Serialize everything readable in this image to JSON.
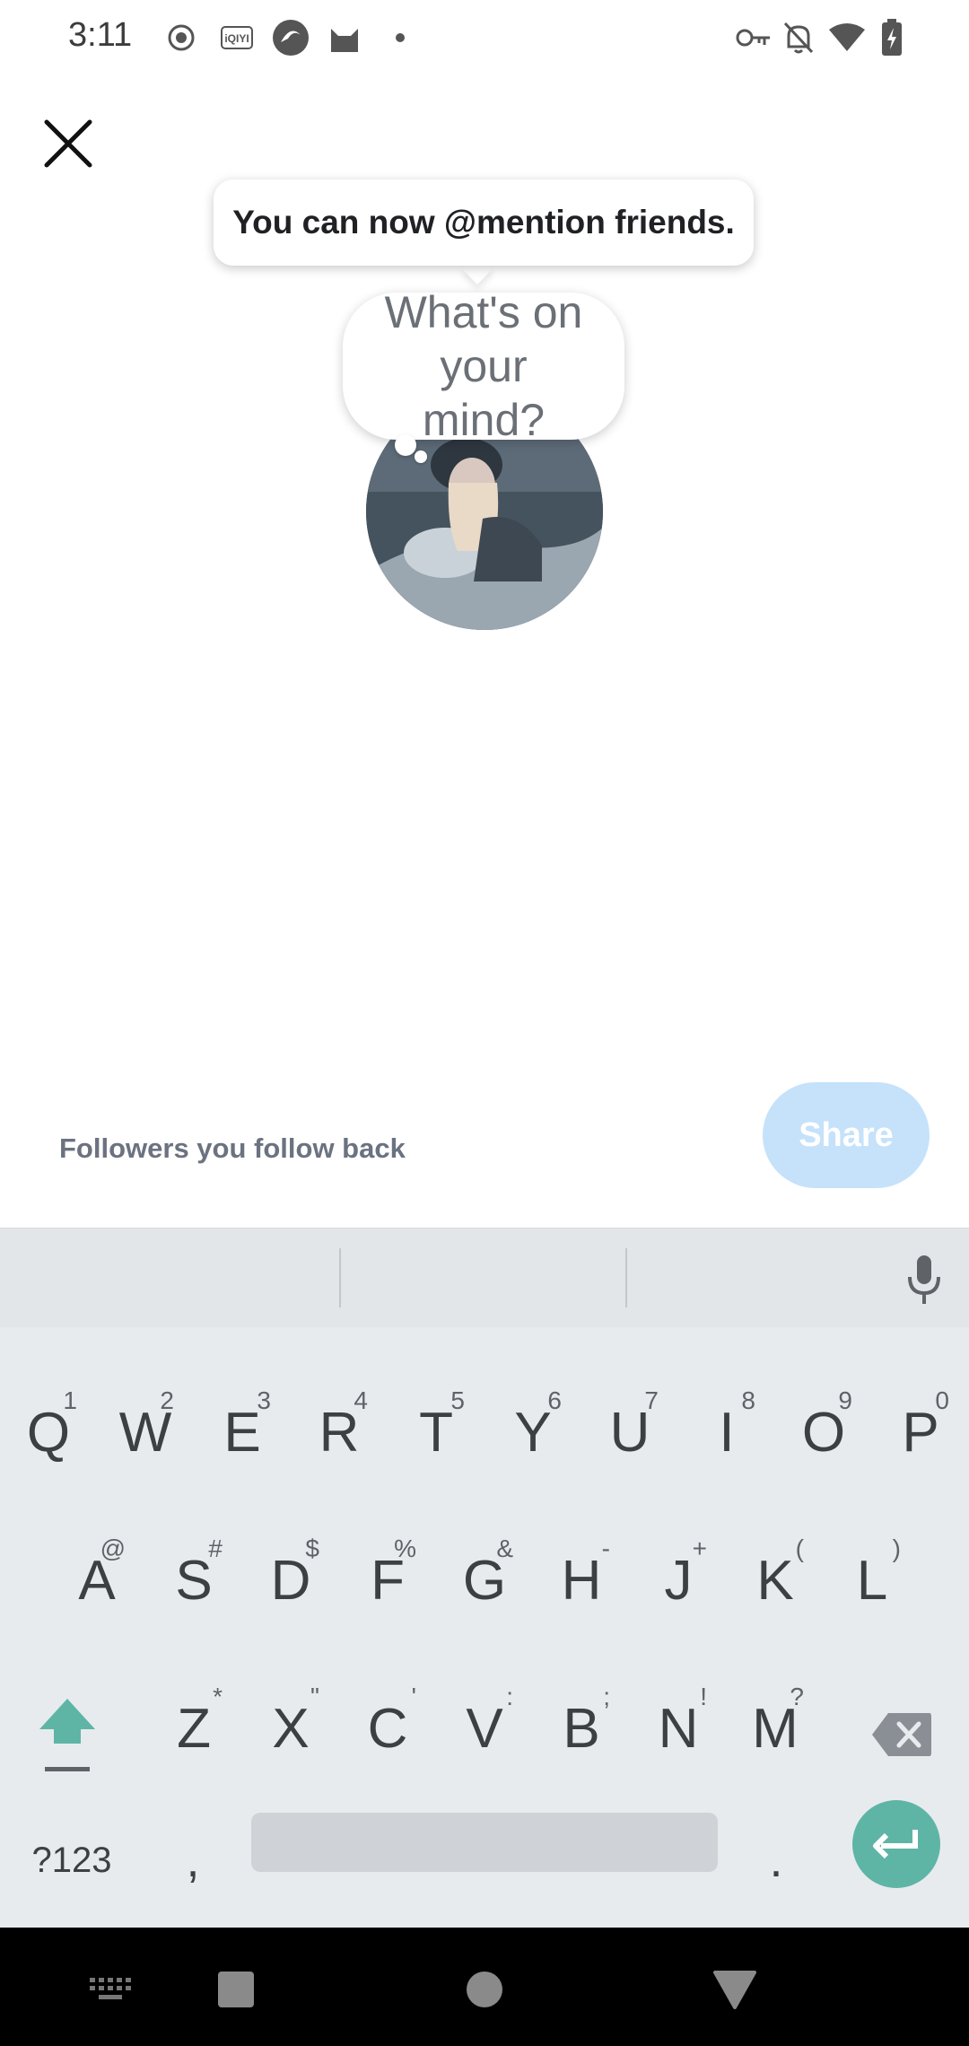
{
  "status_bar": {
    "time": "3:11",
    "left_icons": [
      "record-icon",
      "iqiyi-icon",
      "browser-icon",
      "cat-icon",
      "dot-icon"
    ],
    "right_icons": [
      "vpn-key-icon",
      "mute-bell-icon",
      "wifi-icon",
      "battery-charging-icon"
    ]
  },
  "composer": {
    "tooltip": "You can now @mention friends.",
    "placeholder": "What's on your mind?",
    "audience_label": "Followers you follow back",
    "share_label": "Share",
    "share_color": "#c5e2fa"
  },
  "keyboard": {
    "row1": [
      {
        "k": "Q",
        "h": "1"
      },
      {
        "k": "W",
        "h": "2"
      },
      {
        "k": "E",
        "h": "3"
      },
      {
        "k": "R",
        "h": "4"
      },
      {
        "k": "T",
        "h": "5"
      },
      {
        "k": "Y",
        "h": "6"
      },
      {
        "k": "U",
        "h": "7"
      },
      {
        "k": "I",
        "h": "8"
      },
      {
        "k": "O",
        "h": "9"
      },
      {
        "k": "P",
        "h": "0"
      }
    ],
    "row2": [
      {
        "k": "A",
        "h": "@"
      },
      {
        "k": "S",
        "h": "#"
      },
      {
        "k": "D",
        "h": "$"
      },
      {
        "k": "F",
        "h": "%"
      },
      {
        "k": "G",
        "h": "&"
      },
      {
        "k": "H",
        "h": "-"
      },
      {
        "k": "J",
        "h": "+"
      },
      {
        "k": "K",
        "h": "("
      },
      {
        "k": "L",
        "h": ")"
      }
    ],
    "row3": [
      {
        "k": "Z",
        "h": "*"
      },
      {
        "k": "X",
        "h": "\""
      },
      {
        "k": "C",
        "h": "'"
      },
      {
        "k": "V",
        "h": ":"
      },
      {
        "k": "B",
        "h": ";"
      },
      {
        "k": "N",
        "h": "!"
      },
      {
        "k": "M",
        "h": "?"
      }
    ],
    "symbols_label": "?123",
    "comma_label": ",",
    "period_label": ".",
    "accent_color": "#5eb5a6"
  }
}
